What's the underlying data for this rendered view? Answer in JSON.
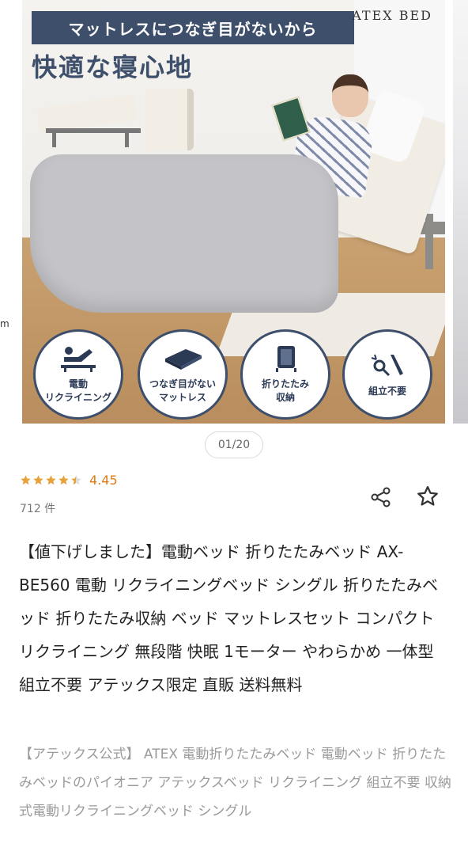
{
  "carousel": {
    "prev_fragment": "m",
    "brand": "ATEX BED",
    "banner": "マットレスにつなぎ目がないから",
    "headline": "快適な寝心地",
    "features": [
      {
        "icon": "recline-icon",
        "label_lines": [
          "電動",
          "リクライニング"
        ]
      },
      {
        "icon": "mattress-icon",
        "label_lines": [
          "つなぎ目がない",
          "マットレス"
        ]
      },
      {
        "icon": "fold-icon",
        "label_lines": [
          "折りたたみ",
          "収納"
        ]
      },
      {
        "icon": "tools-icon",
        "label_lines": [
          "組立不要"
        ]
      }
    ],
    "pager": "01/20"
  },
  "rating": {
    "value": "4.45",
    "stars": 4.45,
    "count": "712 件",
    "star_color": "#e6a23c",
    "value_color": "#e07a16"
  },
  "actions": {
    "share_icon": "share-icon",
    "favorite_icon": "star-outline-icon"
  },
  "product": {
    "title": "【値下げしました】電動ベッド 折りたたみベッド AX-BE560 電動 リクライニングベッド シングル 折りたたみベッド 折りたたみ収納 ベッド マットレスセット コンパクト リクライニング 無段階 快眠 1モーター やわらかめ 一体型 組立不要 アテックス限定 直販 送料無料",
    "subtitle": "【アテックス公式】 ATEX 電動折りたたみベッド 電動ベッド 折りたたみベッドのパイオニア アテックスベッド リクライニング 組立不要 収納式電動リクライニングベッド シングル"
  },
  "colors": {
    "accent": "#3e4f6b"
  }
}
